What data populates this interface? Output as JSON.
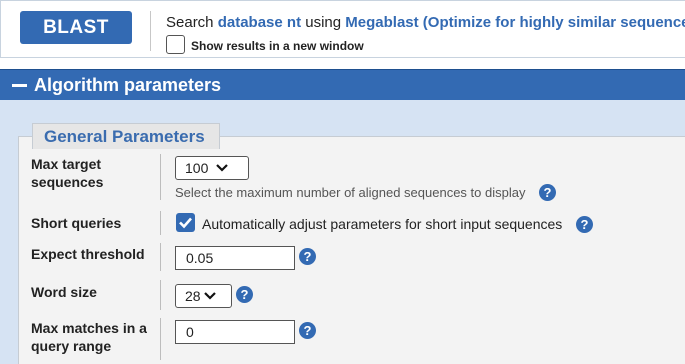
{
  "submit_bar": {
    "blast_button": "BLAST",
    "search_prefix": "Search ",
    "database_link": "database nt",
    "using_text": " using ",
    "program_link": "Megablast (Optimize for highly similar sequences)",
    "new_window_label": "Show results in a new window",
    "new_window_checked": false
  },
  "algorithm_section": {
    "title": "Algorithm parameters",
    "toggle_icon": "minus-icon"
  },
  "general_parameters": {
    "legend": "General Parameters",
    "max_target": {
      "label_line1": "Max target",
      "label_line2": "sequences",
      "value": "100",
      "hint": "Select the maximum number of aligned sequences to display"
    },
    "short_queries": {
      "label": "Short queries",
      "checked": true,
      "checkbox_label": "Automatically adjust parameters for short input sequences"
    },
    "expect_threshold": {
      "label": "Expect threshold",
      "value": "0.05"
    },
    "word_size": {
      "label": "Word size",
      "value": "28"
    },
    "max_matches": {
      "label_line1": "Max matches in a",
      "label_line2": "query range",
      "value": "0"
    },
    "help_icon": "?"
  },
  "colors": {
    "accent": "#336ab3",
    "section_bg": "#d6e3f3",
    "fieldset_bg": "#f3f3f3"
  }
}
